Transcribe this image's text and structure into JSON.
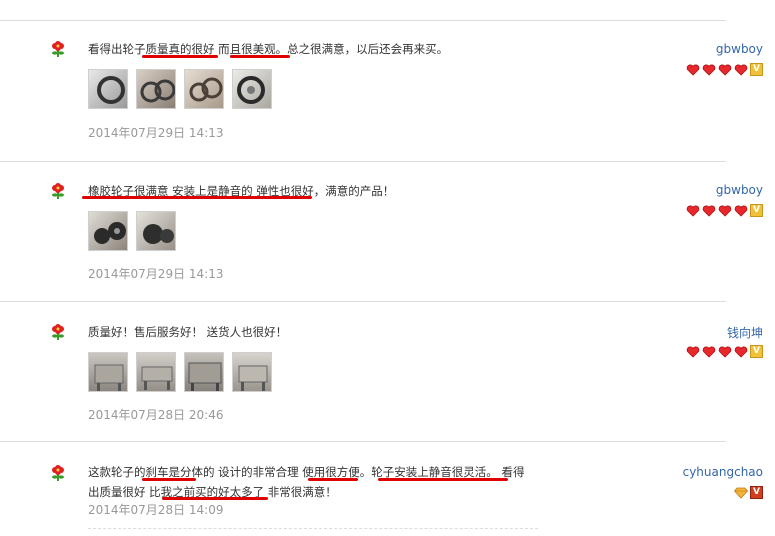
{
  "reviews": [
    {
      "text": "看得出轮子质量真的很好 而且很美观。总之很满意，以后还会再来买。",
      "date": "2014年07月29日  14:13",
      "user": "gbwboy",
      "rank": "hearts"
    },
    {
      "text": "橡胶轮子很满意 安装上是静音的 弹性也很好，满意的产品！",
      "date": "2014年07月29日  14:13",
      "user": "gbwboy",
      "rank": "hearts"
    },
    {
      "text": "质量好！售后服务好！ 送货人也很好！",
      "date": "2014年07月28日  20:46",
      "user": "钱向坤",
      "rank": "hearts"
    },
    {
      "text": "这款轮子的刹车是分体的 设计的非常合理 使用很方便。轮子安装上静音很灵活。 看得出质量很好 比我之前买的好太多了 非常很满意！",
      "date": "2014年07月28日  14:09",
      "user": "cyhuangchao",
      "rank": "diamond"
    }
  ]
}
